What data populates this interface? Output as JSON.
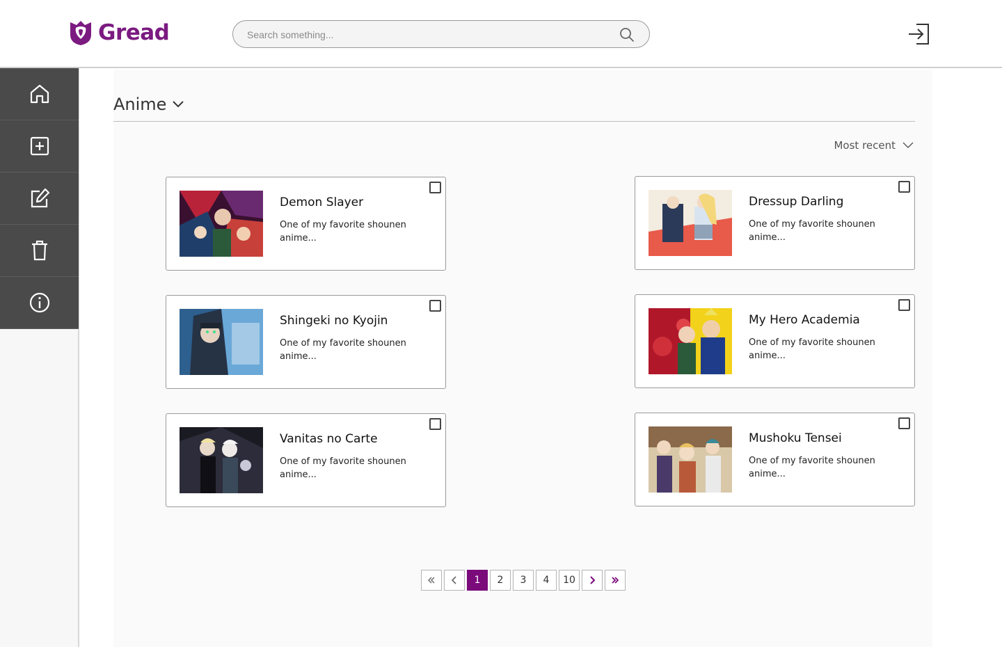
{
  "app": {
    "name": "Gread",
    "brand_color": "#7b1a80"
  },
  "header": {
    "search_placeholder": "Search something...",
    "search_icon": "search-icon",
    "logout_icon": "logout-icon"
  },
  "sidebar": {
    "items": [
      {
        "icon": "home-icon"
      },
      {
        "icon": "add-icon"
      },
      {
        "icon": "edit-icon"
      },
      {
        "icon": "trash-icon"
      },
      {
        "icon": "info-icon"
      }
    ]
  },
  "main": {
    "category": "Anime",
    "sort_label": "Most recent",
    "cards": [
      {
        "title": "Demon Slayer",
        "desc": "One of my favorite shounen anime..."
      },
      {
        "title": "Dressup Darling",
        "desc": "One of my favorite shounen anime..."
      },
      {
        "title": "Shingeki no Kyojin",
        "desc": "One of my favorite shounen anime..."
      },
      {
        "title": "My Hero Academia",
        "desc": "One of my favorite shounen anime..."
      },
      {
        "title": "Vanitas no Carte",
        "desc": "One of my favorite shounen anime..."
      },
      {
        "title": "Mushoku Tensei",
        "desc": "One of my favorite shounen anime..."
      }
    ]
  },
  "pagination": {
    "pages": [
      "1",
      "2",
      "3",
      "4",
      "10"
    ],
    "current": "1",
    "active_color": "#7b0a7b"
  }
}
